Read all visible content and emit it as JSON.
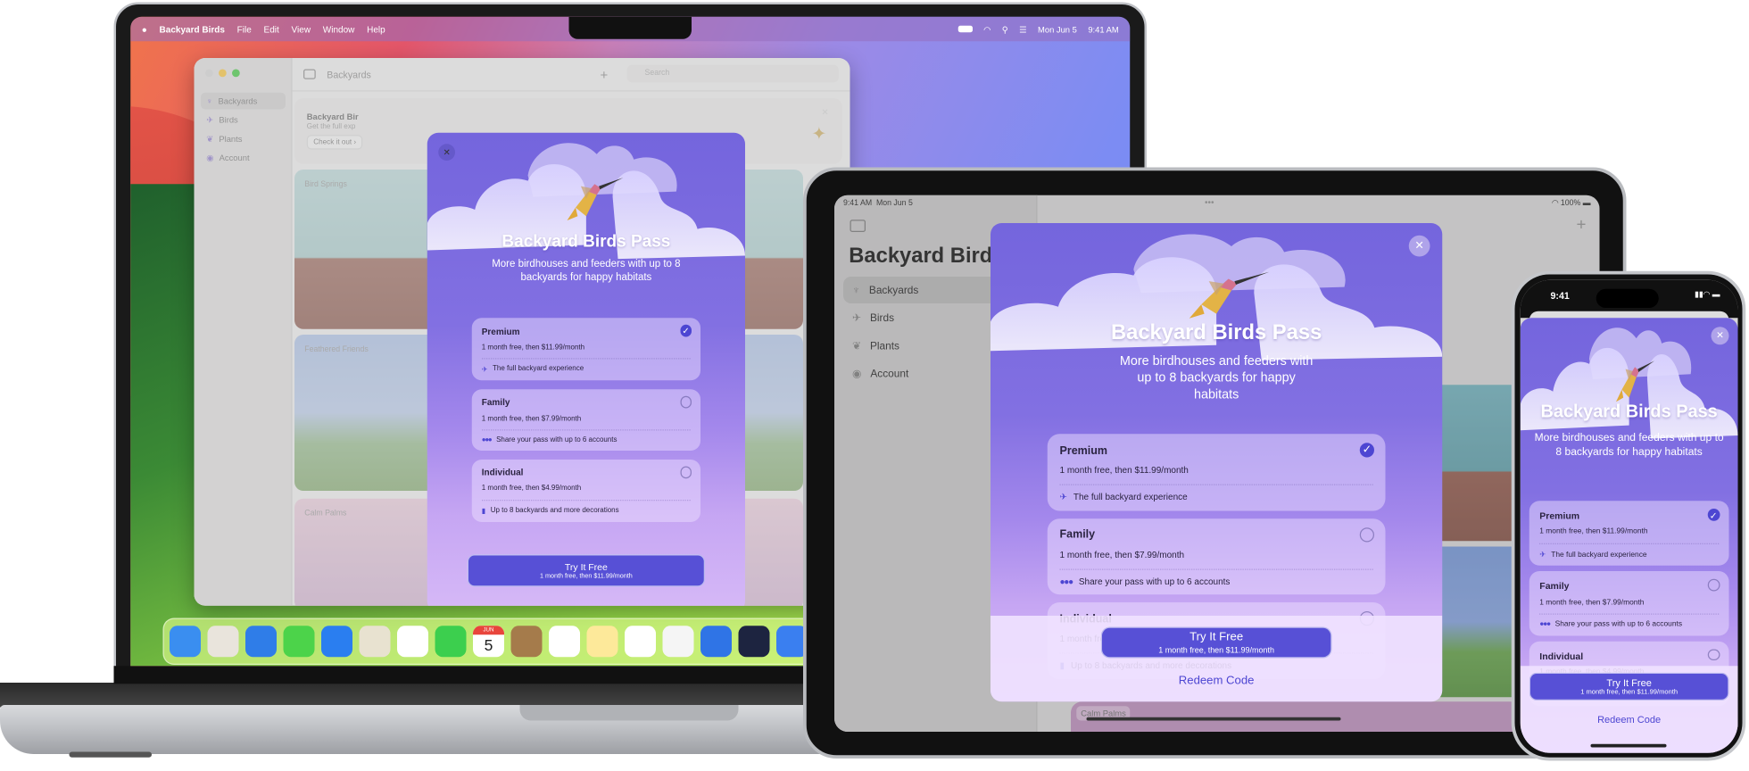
{
  "mac": {
    "menubar": {
      "app_name": "Backyard Birds",
      "menus": [
        "File",
        "Edit",
        "View",
        "Window",
        "Help"
      ],
      "date": "Mon Jun 5",
      "time": "9:41 AM"
    },
    "window": {
      "toolbar_title": "Backyards",
      "search_placeholder": "Search",
      "sidebar": [
        {
          "label": "Backyards",
          "icon": "birdbath-icon",
          "selected": true
        },
        {
          "label": "Birds",
          "icon": "bird-icon"
        },
        {
          "label": "Plants",
          "icon": "leaf-icon"
        },
        {
          "label": "Account",
          "icon": "account-icon"
        }
      ],
      "banner": {
        "title": "Backyard Bir",
        "subtitle": "Get the full exp",
        "button": "Check it out"
      },
      "backyards": [
        "Bird Springs",
        "Feathered Friends",
        "Calm Palms"
      ]
    },
    "dock": {
      "apps": [
        "finder",
        "launchpad",
        "safari",
        "messages",
        "mail",
        "maps",
        "photos",
        "facetime",
        "calendar",
        "contacts",
        "reminders",
        "notes",
        "freeform",
        "backyard-birds",
        "xcode",
        "instruments",
        "simulator"
      ],
      "calendar_month": "JUN",
      "calendar_day": "5"
    }
  },
  "ipad": {
    "status": {
      "time": "9:41 AM",
      "date": "Mon Jun 5",
      "battery": "100%"
    },
    "sidebar_title": "Backyard Birds",
    "sidebar": [
      {
        "label": "Backyards",
        "icon": "birdbath-icon",
        "selected": true
      },
      {
        "label": "Birds",
        "icon": "bird-icon"
      },
      {
        "label": "Plants",
        "icon": "leaf-icon"
      },
      {
        "label": "Account",
        "icon": "account-icon"
      }
    ],
    "backyard_label": "Calm Palms"
  },
  "iphone": {
    "status": {
      "time": "9:41"
    }
  },
  "paywall": {
    "title": "Backyard Birds Pass",
    "subtitle": "More birdhouses and feeders with up to 8 backyards for happy habitats",
    "plans": [
      {
        "name": "Premium",
        "price": "1 month free, then $11.99/month",
        "feature": "The full backyard experience",
        "icon": "hummingbird-icon",
        "selected": true
      },
      {
        "name": "Family",
        "price": "1 month free, then $7.99/month",
        "feature": "Share your pass with up to 6 accounts",
        "icon": "people-icon",
        "selected": false
      },
      {
        "name": "Individual",
        "price": "1 month free, then $4.99/month",
        "feature": "Up to 8 backyards and more decorations",
        "icon": "phone-icon",
        "selected": false
      }
    ],
    "cta_title": "Try It Free",
    "cta_subtitle": "1 month free, then $11.99/month",
    "redeem": "Redeem Code",
    "close": "✕",
    "accent": "#5750d6"
  }
}
